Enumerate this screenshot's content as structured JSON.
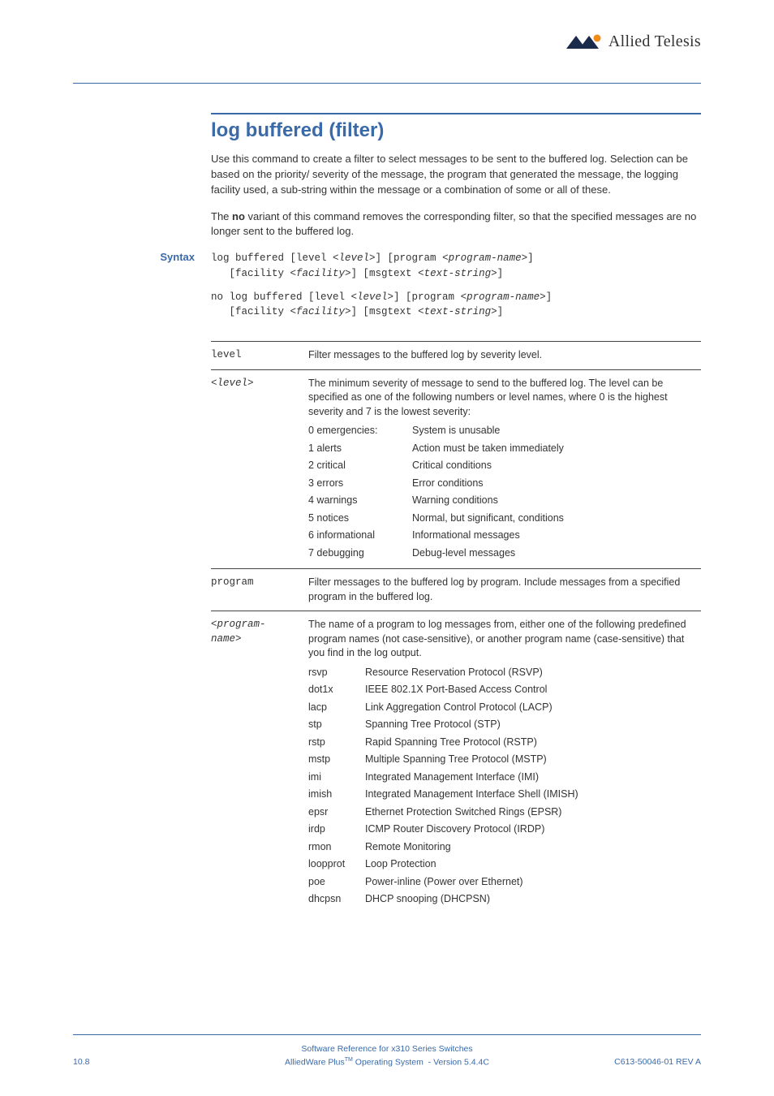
{
  "brand": "Allied Telesis",
  "title": "log buffered (filter)",
  "intro1": "Use this command to create a filter to select messages to be sent to the buffered log. Selection can be based on the priority/ severity of the message, the program that generated the message, the logging facility used, a sub-string within the message or a combination of some or all of these.",
  "intro2a": "The ",
  "intro2b": "no",
  "intro2c": " variant of this command removes the corresponding filter, so that the specified messages are no longer sent to the buffered log.",
  "syntaxLabel": "Syntax",
  "code1": "log buffered [level <level>] [program <program-name>]\n   [facility <facility>] [msgtext <text-string>]",
  "code2": "no log buffered [level <level>] [program <program-name>]\n   [facility <facility>] [msgtext <text-string>]",
  "rows": {
    "level": {
      "key": "level",
      "desc": "Filter messages to the buffered log by severity level."
    },
    "levelArg": {
      "key": "<level>",
      "desc": "The minimum severity of message to send to the buffered log. The level can be specified as one of the following numbers or level names, where 0 is the highest severity and 7 is the lowest severity:",
      "levels": [
        {
          "n": "0",
          "name": "emergencies:",
          "d": "System is unusable"
        },
        {
          "n": "1",
          "name": "alerts",
          "d": "Action must be taken immediately"
        },
        {
          "n": "2",
          "name": "critical",
          "d": "Critical conditions"
        },
        {
          "n": "3",
          "name": "errors",
          "d": "Error conditions"
        },
        {
          "n": "4",
          "name": "warnings",
          "d": "Warning conditions"
        },
        {
          "n": "5",
          "name": "notices",
          "d": "Normal, but significant, conditions"
        },
        {
          "n": "6",
          "name": "informational",
          "d": "Informational messages"
        },
        {
          "n": "7",
          "name": "debugging",
          "d": "Debug-level messages"
        }
      ]
    },
    "program": {
      "key": "program",
      "desc": "Filter messages to the buffered log by program. Include messages from a specified program in the buffered log."
    },
    "programArg": {
      "key": "<program-name>",
      "desc": "The name of a program to log messages from, either one of the following predefined program names (not case-sensitive), or another program name (case-sensitive) that you find in the log output.",
      "progs": [
        {
          "k": "rsvp",
          "d": "Resource Reservation Protocol (RSVP)"
        },
        {
          "k": "dot1x",
          "d": "IEEE 802.1X Port-Based Access Control"
        },
        {
          "k": "lacp",
          "d": "Link Aggregation Control Protocol (LACP)"
        },
        {
          "k": "stp",
          "d": "Spanning Tree Protocol (STP)"
        },
        {
          "k": "rstp",
          "d": "Rapid Spanning Tree Protocol (RSTP)"
        },
        {
          "k": "mstp",
          "d": "Multiple Spanning Tree Protocol (MSTP)"
        },
        {
          "k": "imi",
          "d": "Integrated Management Interface (IMI)"
        },
        {
          "k": "imish",
          "d": "Integrated Management Interface Shell (IMISH)"
        },
        {
          "k": "epsr",
          "d": "Ethernet Protection Switched Rings (EPSR)"
        },
        {
          "k": "irdp",
          "d": "ICMP Router Discovery Protocol (IRDP)"
        },
        {
          "k": "rmon",
          "d": "Remote Monitoring"
        },
        {
          "k": "loopprot",
          "d": "Loop Protection"
        },
        {
          "k": "poe",
          "d": "Power-inline (Power over Ethernet)"
        },
        {
          "k": "dhcpsn",
          "d": "DHCP snooping (DHCPSN)"
        }
      ]
    }
  },
  "footer": {
    "ref": "Software Reference for x310 Series Switches",
    "os": "AlliedWare Plus™ Operating System  - Version 5.4.4C",
    "page": "10.8",
    "docnum": "C613-50046-01 REV A"
  }
}
